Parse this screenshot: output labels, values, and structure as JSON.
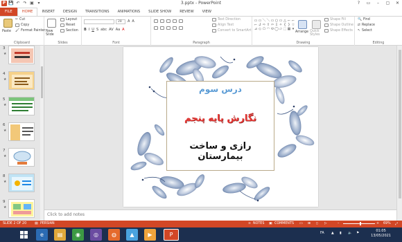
{
  "window": {
    "title": "3.pptx - PowerPoint",
    "controls": [
      "?",
      "▭",
      "–",
      "▢",
      "✕"
    ],
    "qat": [
      "P",
      "💾",
      "↶",
      "↷",
      "▣",
      "▾"
    ]
  },
  "ribbon_tabs": [
    "FILE",
    "HOME",
    "INSERT",
    "DESIGN",
    "TRANSITIONS",
    "ANIMATIONS",
    "SLIDE SHOW",
    "REVIEW",
    "VIEW"
  ],
  "ribbon": {
    "clipboard": {
      "label": "Clipboard",
      "paste": "Paste",
      "cut": "Cut",
      "copy": "Copy",
      "format_painter": "Format Painter"
    },
    "slides": {
      "label": "Slides",
      "new_slide": "New Slide",
      "layout": "Layout",
      "reset": "Reset",
      "section": "Section"
    },
    "font": {
      "label": "Font",
      "font_name": "",
      "font_size": "28",
      "bold": "B",
      "italic": "I",
      "underline": "U",
      "strike": "S",
      "shadow": "abc",
      "spacing": "AV",
      "case": "Aa",
      "color": "A",
      "grow": "A",
      "shrink": "A"
    },
    "paragraph": {
      "label": "Paragraph",
      "text_direction": "Text Direction",
      "align_text": "Align Text",
      "smartart": "Convert to SmartArt"
    },
    "drawing": {
      "label": "Drawing",
      "arrange": "Arrange",
      "quick_styles": "Quick Styles",
      "shape_fill": "Shape Fill",
      "shape_outline": "Shape Outline",
      "shape_effects": "Shape Effects"
    },
    "editing": {
      "label": "Editing",
      "find": "Find",
      "replace": "Replace",
      "select": "Select"
    }
  },
  "thumbnails": [
    {
      "num": "3"
    },
    {
      "num": "4"
    },
    {
      "num": "5"
    },
    {
      "num": "6"
    },
    {
      "num": "7"
    },
    {
      "num": "8"
    },
    {
      "num": "9"
    }
  ],
  "slide": {
    "line1": "درس سوم",
    "line2": "نگارش پایه پنجم",
    "line3": "رازی و ساخت بیمارستان"
  },
  "notes_placeholder": "Click to add notes",
  "status": {
    "slide_of": "SLIDE 2 OF 20",
    "language": "PERSIAN",
    "notes": "NOTES",
    "comments": "COMMENTS",
    "zoom": "69%"
  },
  "taskbar": {
    "time": "01:05",
    "date": "13/05/2021",
    "tray_lang": "FA"
  },
  "colors": {
    "accent": "#d24726",
    "taskbar": "#1c2f4f"
  }
}
